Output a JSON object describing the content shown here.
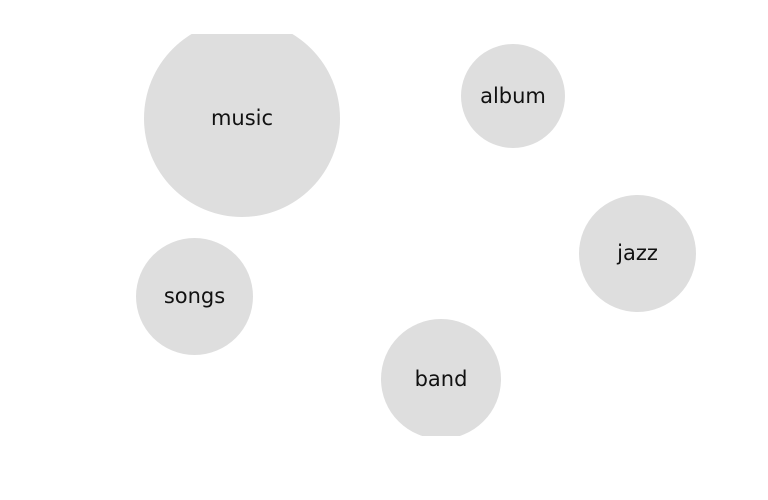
{
  "bubble_color": "#dedede",
  "text_color": "#111111",
  "bubbles": [
    {
      "label": "music"
    },
    {
      "label": "album"
    },
    {
      "label": "jazz"
    },
    {
      "label": "songs"
    },
    {
      "label": "band"
    }
  ]
}
